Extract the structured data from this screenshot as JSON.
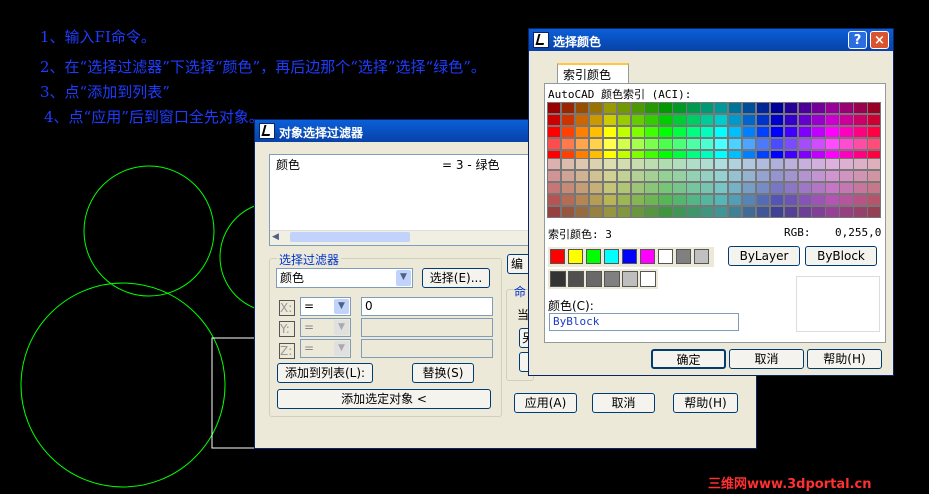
{
  "instructions": [
    "1、输入FI命令。",
    "2、在“选择过滤器”下选择“颜色”，再后边那个“选择”选择“绿色”。",
    "3、点“添加到列表”",
    "4、点“应用”后到窗口全先对象。"
  ],
  "filter_dialog": {
    "title": "对象选择过滤器",
    "list_row": {
      "name": "颜色",
      "value": "= 3 - 绿色"
    },
    "group_title": "选择过滤器",
    "filter_combo": "颜色",
    "select_button": "选择(E)...",
    "x_label": "X:",
    "y_label": "Y:",
    "z_label": "Z:",
    "x_op": "=",
    "y_op": "=",
    "z_op": "=",
    "x_value": "0",
    "add_to_list_button": "添加到列表(L):",
    "replace_button": "替换(S)",
    "add_selected_button": "添加选定对象 <",
    "edit_button": "编辑",
    "named_label": "命",
    "current_label": "当",
    "save_label": "另",
    "apply_button": "应用(A)",
    "cancel_button": "取消",
    "help_button": "帮助(H)"
  },
  "color_dialog": {
    "title": "选择颜色",
    "tab_label": "索引颜色",
    "aci_label": "AutoCAD 颜色索引 (ACI):",
    "index_label": "索引颜色: 3",
    "rgb_label": "RGB:",
    "rgb_value": "0,255,0",
    "bylayer_button": "ByLayer",
    "byblock_button": "ByBlock",
    "color_label": "颜色(C):",
    "color_value": "ByBlock",
    "ok_button": "确定",
    "cancel_button": "取消",
    "help_button": "帮助(H)",
    "help_icon": "?",
    "close_icon": "×",
    "standard_colors": [
      "#ff0000",
      "#ffff00",
      "#00ff00",
      "#00ffff",
      "#0000ff",
      "#ff00ff",
      "#ffffff",
      "#808080",
      "#c0c0c0"
    ],
    "gray_colors": [
      "#333333",
      "#505050",
      "#696969",
      "#808080",
      "#bebebe",
      "#ffffff"
    ]
  },
  "watermark": "三维网www.3dportal.cn"
}
